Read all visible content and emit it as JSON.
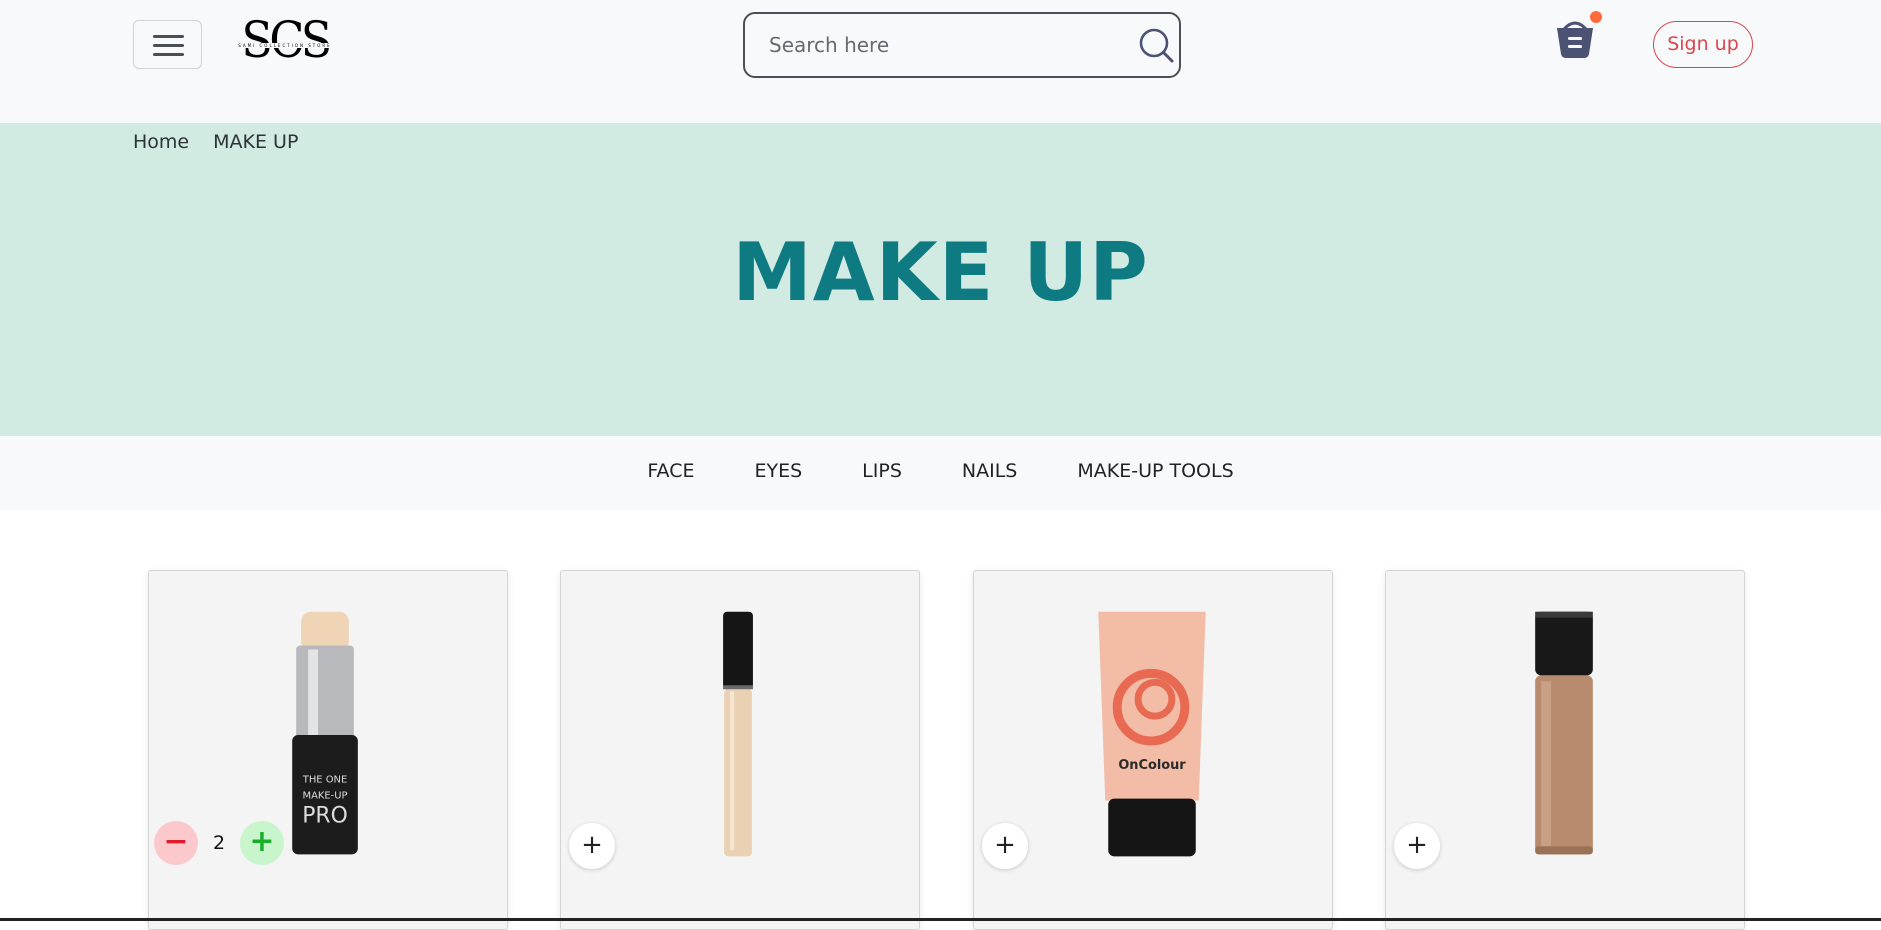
{
  "header": {
    "logo_text": "SCS",
    "logo_subtitle": "SAMI COLLECTION STORE",
    "search_placeholder": "Search here",
    "signup_label": "Sign up",
    "icons": {
      "menu": "hamburger-icon",
      "search": "search-icon",
      "cart": "basket-icon"
    }
  },
  "breadcrumb": [
    "Home",
    "MAKE UP"
  ],
  "page_title": "MAKE UP",
  "categories": [
    "FACE",
    "EYES",
    "LIPS",
    "NAILS",
    "MAKE-UP TOOLS"
  ],
  "products": [
    {
      "image": "foundation-stick",
      "quantity": "2",
      "minus_label": "−",
      "plus_label": "+"
    },
    {
      "image": "concealer-wand",
      "add_label": "+"
    },
    {
      "image": "oncolour-tube",
      "add_label": "+"
    },
    {
      "image": "foundation-bottle",
      "add_label": "+"
    }
  ],
  "colors": {
    "header_bg": "#f8f9fa",
    "banner_bg": "#d1eae2",
    "title": "#0e7b83",
    "signup": "#d9474e",
    "cart_dot": "#ff6a3d",
    "cart_icon": "#4b5273"
  }
}
